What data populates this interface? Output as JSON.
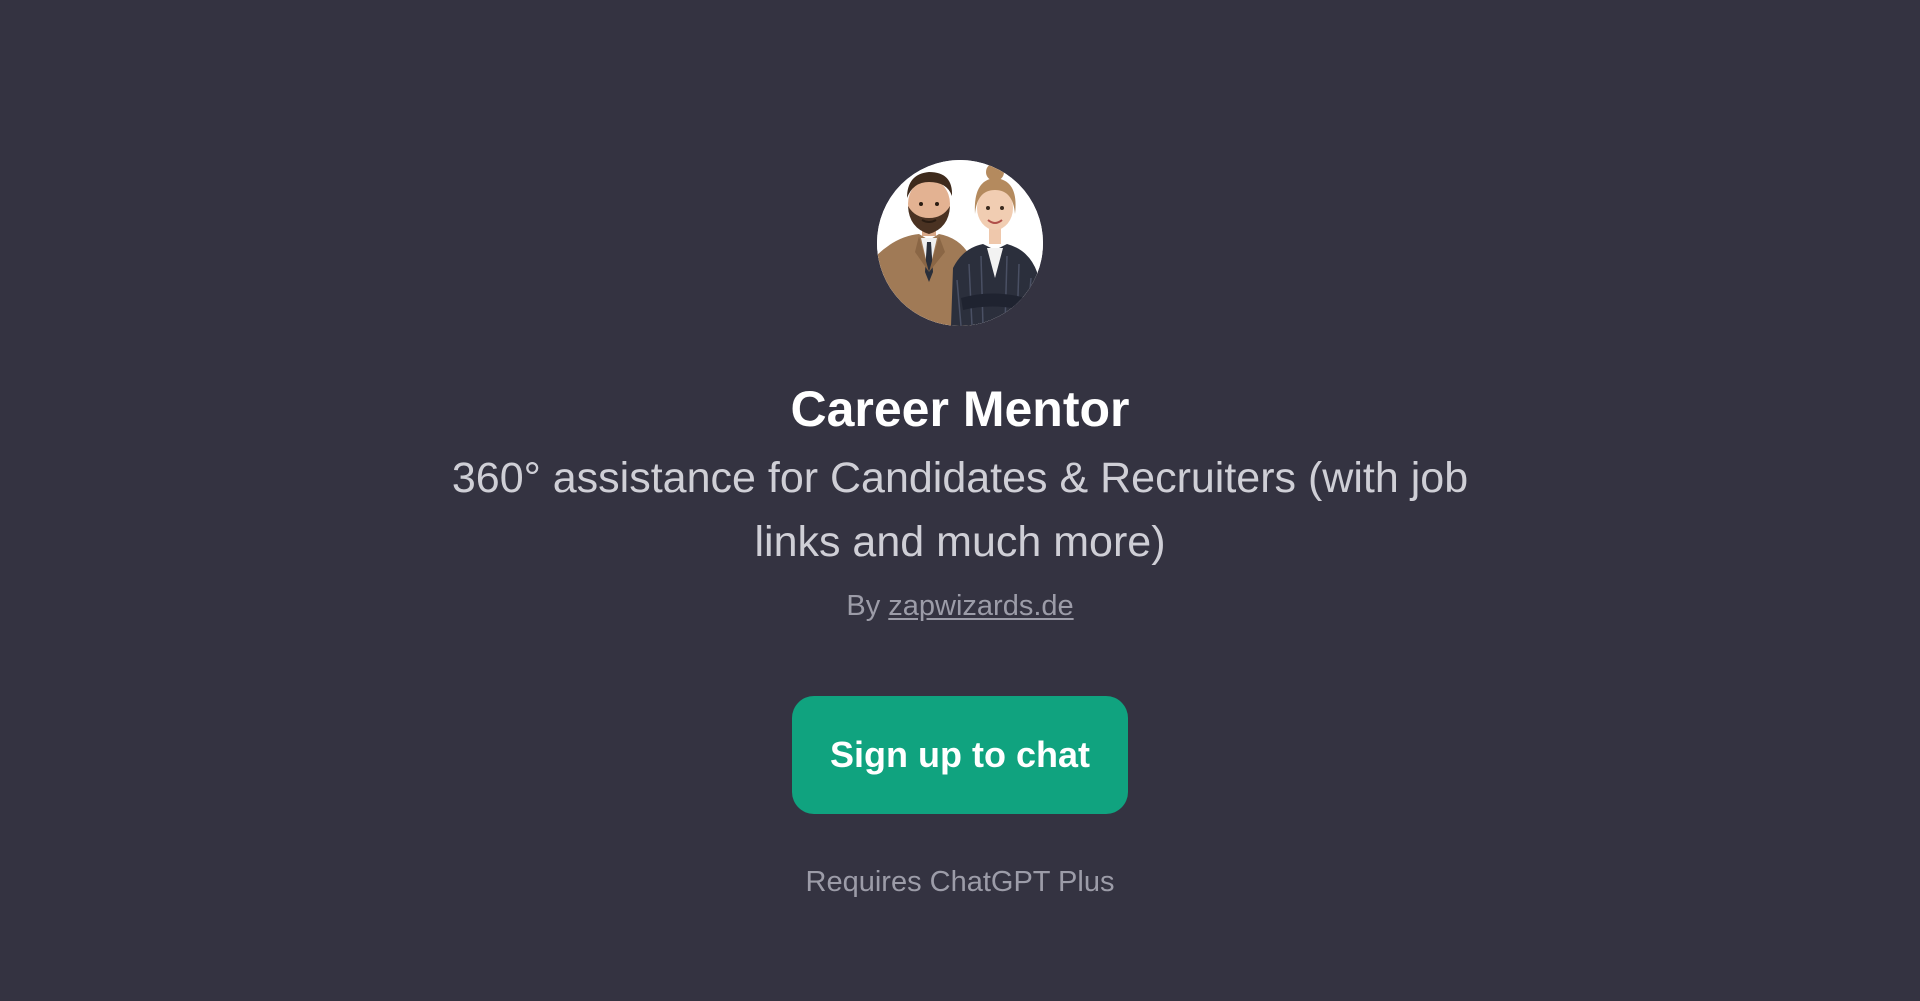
{
  "gpt": {
    "name": "Career Mentor",
    "description": "360° assistance for Candidates & Recruiters (with job links and much more)",
    "byline_prefix": "By",
    "author": "zapwizards.de"
  },
  "actions": {
    "signup_label": "Sign up to chat"
  },
  "footer": {
    "requirement": "Requires ChatGPT Plus"
  },
  "colors": {
    "background": "#343341",
    "accent": "#10a37f",
    "title": "#ffffff",
    "muted": "#9c9ca8"
  },
  "icons": {
    "avatar": "career-mentor-avatar-illustration"
  }
}
